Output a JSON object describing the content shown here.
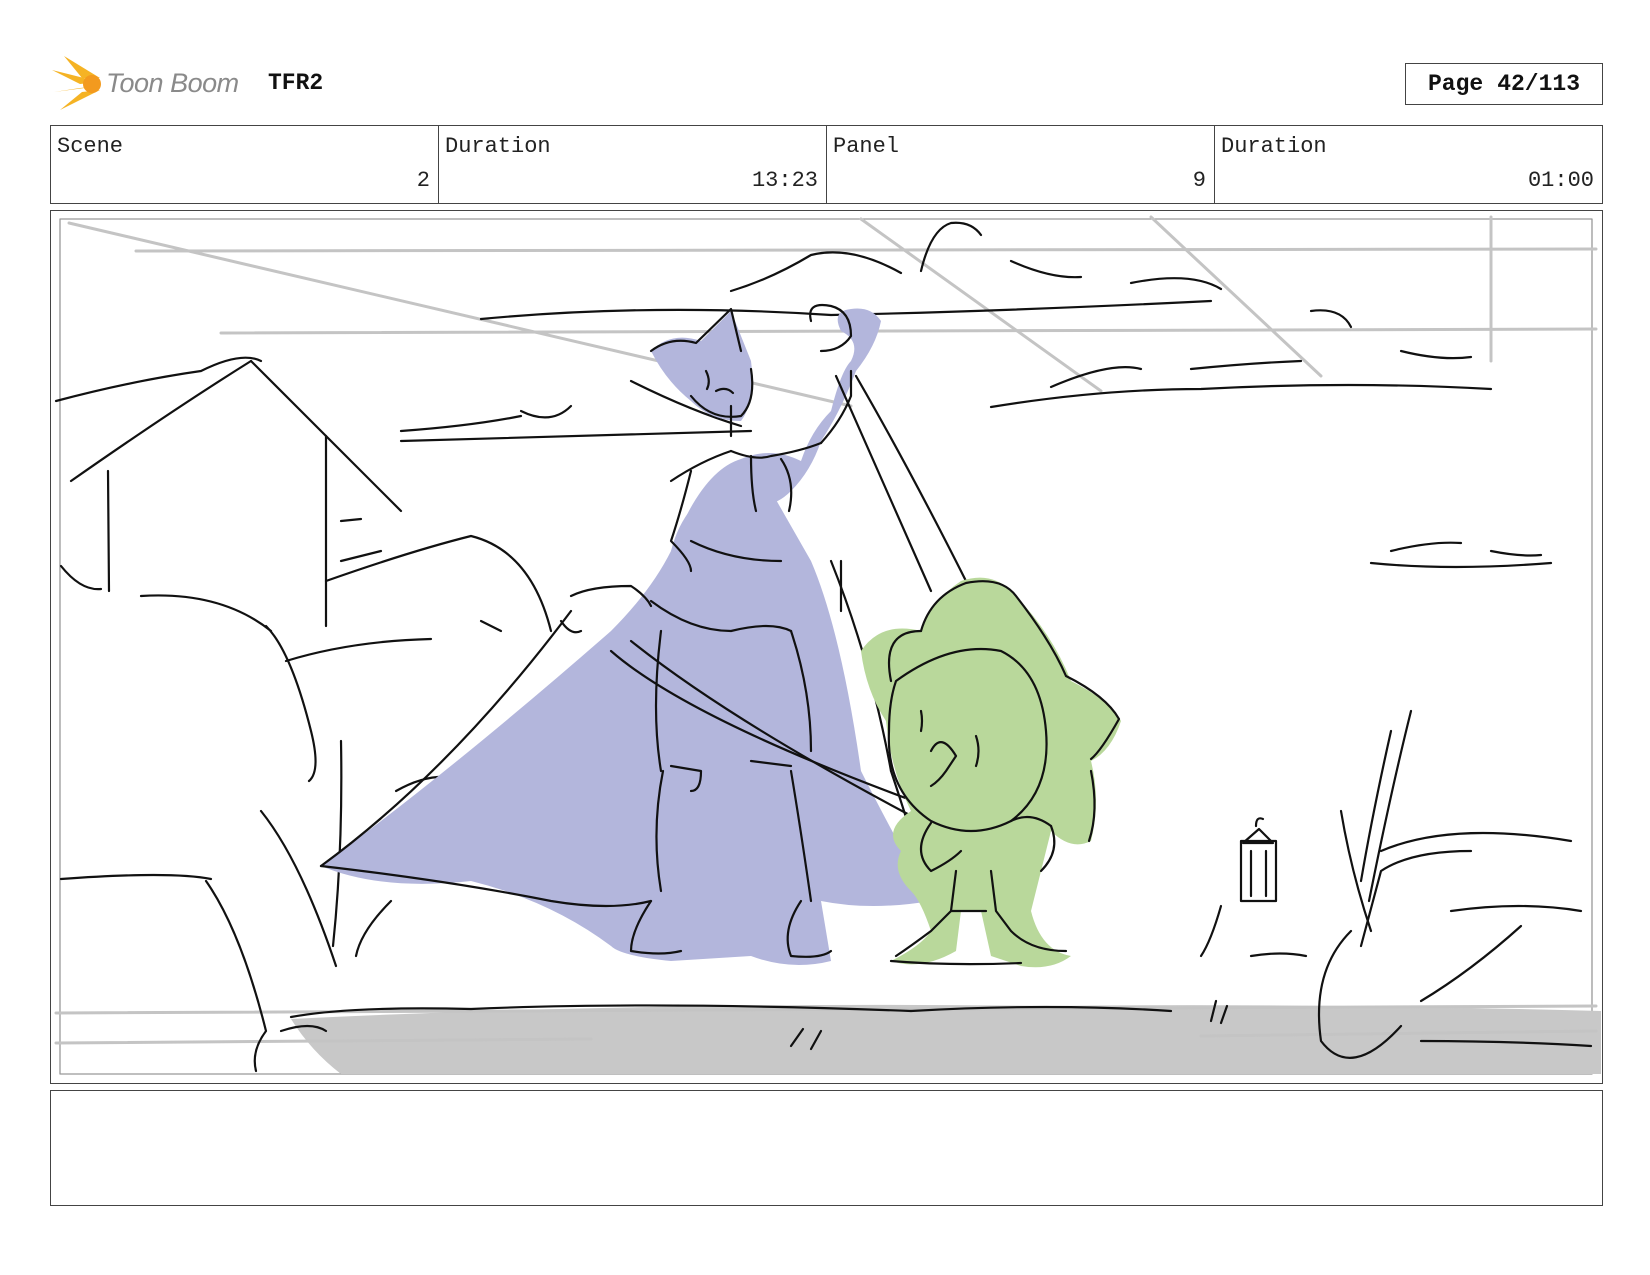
{
  "header": {
    "logo_text": "Toon Boom",
    "project": "TFR2",
    "page_label": "Page",
    "page_number": "42/113"
  },
  "info": {
    "scene_label": "Scene",
    "scene_value": "2",
    "scene_duration_label": "Duration",
    "scene_duration_value": "13:23",
    "panel_label": "Panel",
    "panel_value": "9",
    "panel_duration_label": "Duration",
    "panel_duration_value": "01:00"
  },
  "colors": {
    "logo_orange": "#f5a623",
    "tall_character_fill": "#b3b6dc",
    "small_character_fill": "#b9d89b",
    "ground_fill": "#c8c8c8",
    "guide_lines": "#c4c4c4"
  },
  "notes": {
    "text": ""
  }
}
